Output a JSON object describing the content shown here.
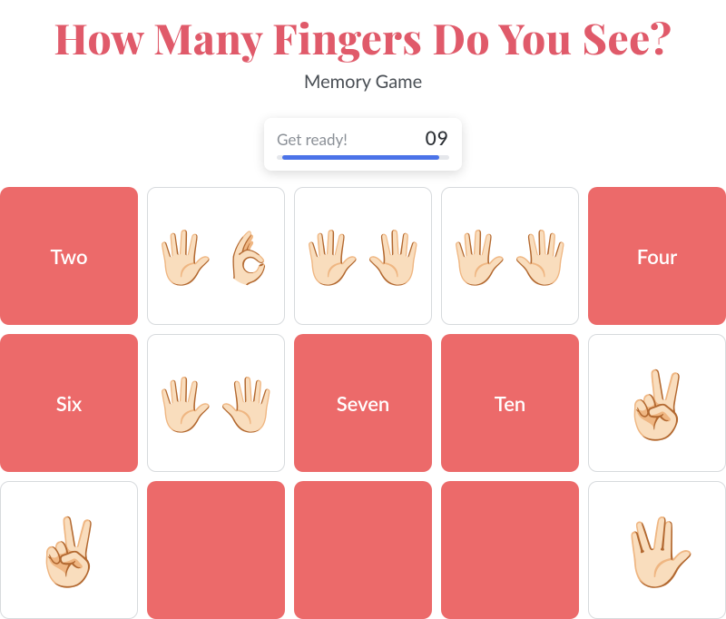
{
  "header": {
    "title": "How Many Fingers Do You See?",
    "subtitle": "Memory Game"
  },
  "status": {
    "label": "Get ready!",
    "time": "09",
    "progress_pct": 94
  },
  "cards": [
    {
      "kind": "word",
      "label": "Two"
    },
    {
      "kind": "picture",
      "hands": [
        "🖐🏻",
        "👌🏻"
      ],
      "alt": "eight-fingers"
    },
    {
      "kind": "picture",
      "hands": [
        "🖐🏻",
        "🖐🏻"
      ],
      "alt": "ten-fingers"
    },
    {
      "kind": "picture",
      "hands": [
        "🖐🏻",
        "🖐🏻"
      ],
      "alt": "ten-fingers"
    },
    {
      "kind": "word",
      "label": "Four"
    },
    {
      "kind": "word",
      "label": "Six"
    },
    {
      "kind": "picture",
      "hands": [
        "🖐🏻",
        "🖐🏻"
      ],
      "alt": "ten-fingers"
    },
    {
      "kind": "word",
      "label": "Seven"
    },
    {
      "kind": "word",
      "label": "Ten"
    },
    {
      "kind": "picture",
      "hands": [
        "✌🏻"
      ],
      "alt": "two-fingers"
    },
    {
      "kind": "picture",
      "hands": [
        "✌🏻"
      ],
      "alt": "two-fingers"
    },
    {
      "kind": "word",
      "label": ""
    },
    {
      "kind": "word",
      "label": ""
    },
    {
      "kind": "word",
      "label": ""
    },
    {
      "kind": "picture",
      "hands": [
        "🖖🏻"
      ],
      "alt": "four-fingers"
    }
  ]
}
